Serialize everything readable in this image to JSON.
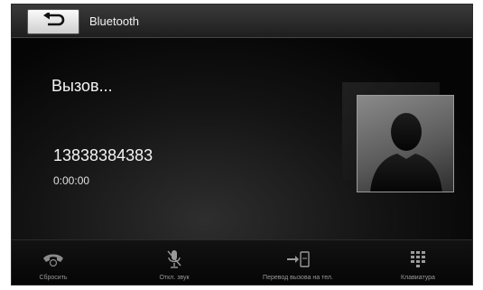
{
  "header": {
    "title": "Bluetooth",
    "back_icon": "back-arrow-icon"
  },
  "call": {
    "status": "Вызов...",
    "number": "13838384383",
    "duration": "0:00:00",
    "avatar_icon": "contact-silhouette-icon"
  },
  "actions": [
    {
      "label": "Сбросить",
      "icon": "hang-up-icon"
    },
    {
      "label": "Откл. звук",
      "icon": "microphone-mute-icon"
    },
    {
      "label": "Перевод вызова на тел.",
      "icon": "transfer-to-phone-icon"
    },
    {
      "label": "Клавиатура",
      "icon": "keypad-icon"
    }
  ]
}
